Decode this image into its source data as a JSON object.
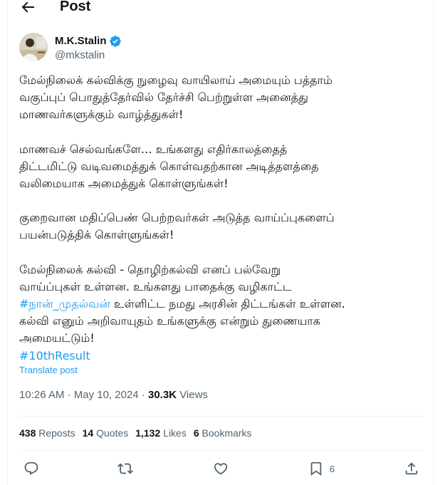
{
  "header": {
    "title": "Post"
  },
  "author": {
    "name": "M.K.Stalin",
    "handle": "@mkstalin"
  },
  "post": {
    "paragraphs": [
      {
        "lines": [
          {
            "text": "மேல்நிலைக் கல்விக்கு நுழைவு வாயிலாய் அமையும் பத்தாம்"
          },
          {
            "text": "வகுப்புப் பொதுத்தேர்வில் தேர்ச்சி பெற்றுள்ள அனைத்து"
          },
          {
            "text": "மாணவர்களுக்கும் வாழ்த்துகள்!"
          }
        ]
      },
      {
        "lines": [
          {
            "text": "மாணவச் செல்வங்களே… உங்களது எதிர்காலத்தைத்"
          },
          {
            "text": "திட்டமிட்டு வடிவமைத்துக் கொள்வதற்கான அடித்தளத்தை"
          },
          {
            "text": "வலிமையாக அமைத்துக் கொள்ளுங்கள்!"
          }
        ]
      },
      {
        "lines": [
          {
            "text": "குறைவான மதிப்பெண் பெற்றவர்கள் அடுத்த வாய்ப்புகளைப்"
          },
          {
            "text": "பயன்படுத்திக் கொள்ளுங்கள்!"
          }
        ]
      },
      {
        "lines": [
          {
            "text": "மேல்நிலைக் கல்வி - தொழிற்கல்வி எனப் பல்வேறு"
          },
          {
            "text": "வாய்ப்புகள் உள்ளன. உங்களது பாதைக்கு வழிகாட்ட"
          },
          {
            "hashtag": "#நான்_முதல்வன்",
            "text": " உள்ளிட்ட நமது அரசின் திட்டங்கள் உள்ளன."
          },
          {
            "text": "கல்வி எனும் அறிவாயுதம் உங்களுக்கு என்றும் துணையாக"
          },
          {
            "text": "அமையட்டும்!"
          },
          {
            "hashtag": "#10thResult",
            "text": ""
          }
        ]
      }
    ],
    "translate_label": "Translate post",
    "time": "10:26 AM",
    "date": "May 10, 2024",
    "views_count": "30.3K",
    "views_label": "Views"
  },
  "stats": {
    "reposts_count": "438",
    "reposts_label": "Reposts",
    "quotes_count": "14",
    "quotes_label": "Quotes",
    "likes_count": "1,132",
    "likes_label": "Likes",
    "bookmarks_count": "6",
    "bookmarks_label": "Bookmarks"
  },
  "actions": {
    "bookmark_count": "6"
  },
  "icons": {
    "back": "arrow-left-icon",
    "verified": "verified-badge-icon",
    "reply": "reply-icon",
    "repost": "repost-icon",
    "like": "heart-icon",
    "bookmark": "bookmark-icon",
    "share": "share-icon"
  },
  "colors": {
    "accent": "#1d9bf0",
    "text": "#0f1419",
    "muted": "#536471",
    "divider": "#eff3f4"
  }
}
